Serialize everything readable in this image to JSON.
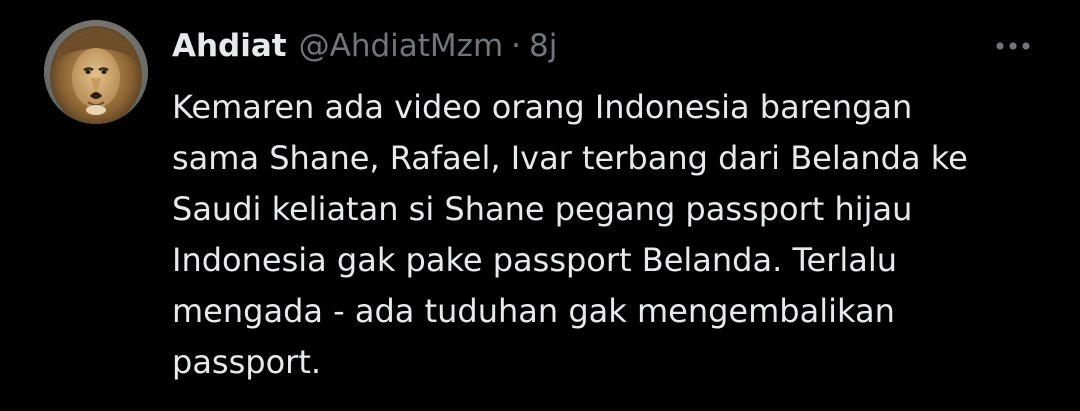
{
  "author": {
    "display_name": "Ahdiat",
    "handle": "@AhdiatMzm",
    "separator": "·",
    "timestamp": "8j",
    "avatar_icon": "lion-avatar"
  },
  "tweet": {
    "lines": [
      "Kemaren ada video orang Indonesia barengan",
      "sama Shane, Rafael, Ivar terbang dari Belanda ke",
      "Saudi keliatan si Shane pegang passport hijau",
      "Indonesia gak pake passport Belanda. Terlalu",
      "mengada - ada tuduhan gak mengembalikan",
      "passport."
    ]
  },
  "actions": {
    "more_icon": "more-horizontal-icon"
  },
  "colors": {
    "background": "#000000",
    "primary_text": "#e7e9ea",
    "secondary_text": "#71767b"
  }
}
